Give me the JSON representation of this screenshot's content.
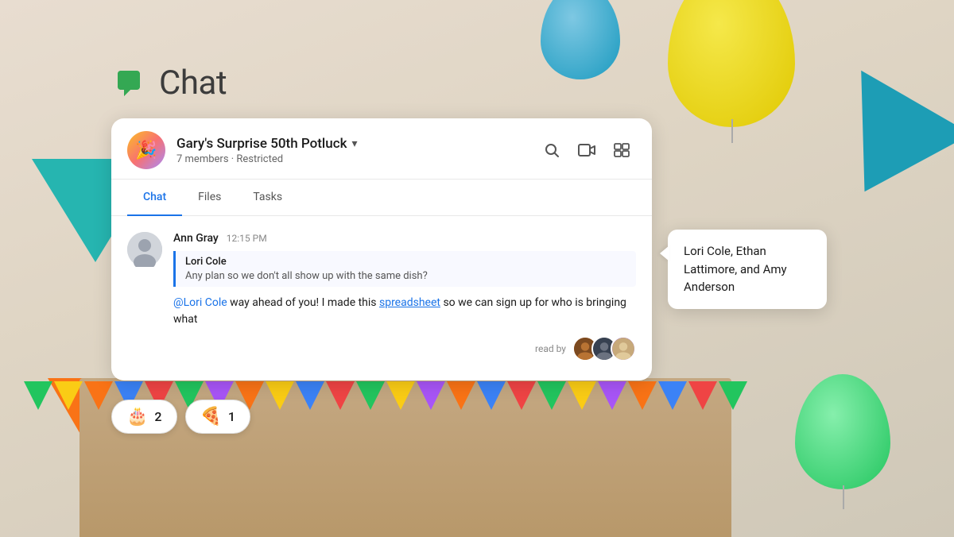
{
  "app": {
    "title": "Chat",
    "logo_emoji": "💬"
  },
  "group": {
    "name": "Gary's Surprise 50th Potluck",
    "avatar_emoji": "🎉",
    "members_count": "7 members",
    "restriction": "Restricted",
    "meta": "7 members · Restricted"
  },
  "tabs": [
    {
      "label": "Chat",
      "active": true
    },
    {
      "label": "Files",
      "active": false
    },
    {
      "label": "Tasks",
      "active": false
    }
  ],
  "message": {
    "sender": "Ann Gray",
    "time": "12:15 PM",
    "quoted_author": "Lori Cole",
    "quoted_text": "Any plan so we don't all show up with the same dish?",
    "mention": "@Lori Cole",
    "text_before_link": " way ahead of you! I made this ",
    "link_text": "spreadsheet",
    "text_after_link": " so we can sign up for who is bringing what"
  },
  "read_by": {
    "label": "read by",
    "avatars": [
      "👩🏾",
      "👨🏽",
      "👩🏼"
    ]
  },
  "tooltip": {
    "text": "Lori Cole, Ethan Lattimore, and Amy Anderson"
  },
  "reactions": [
    {
      "emoji": "🎂",
      "count": "2"
    },
    {
      "emoji": "🍕",
      "count": "1"
    }
  ],
  "icons": {
    "search": "🔍",
    "video": "⬜",
    "menu": "≡",
    "chevron": "▾"
  }
}
